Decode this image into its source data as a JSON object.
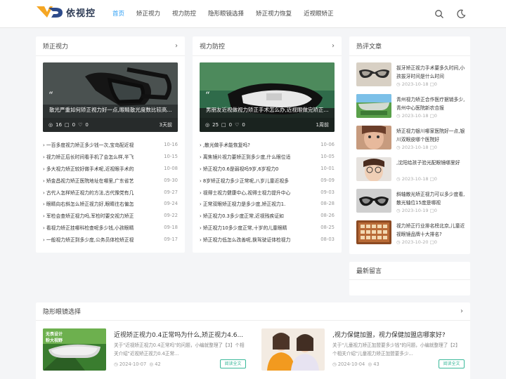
{
  "brand": {
    "name": "依视控",
    "accent": "#2a9df4"
  },
  "nav": {
    "items": [
      "首页",
      "矫正视力",
      "视力防控",
      "隐形眼镜选择",
      "矫正视力恢复",
      "近视眼矫正"
    ],
    "active_index": 0
  },
  "topbar": {
    "search_icon": "search-icon",
    "theme_icon": "moon-icon"
  },
  "section_correct": {
    "title": "矫正视力",
    "hero": {
      "title": "散光严重如何矫正视力好一点,眼睛散光度数比较高...",
      "views": "16",
      "comments": "0",
      "likes": "0",
      "time": "3天前"
    },
    "list": [
      {
        "title": "一百多度视力矫正多少钱一次,宝岛配近视",
        "date": "10-16"
      },
      {
        "title": "视力矫正后长时间看手机了会怎么样,半飞",
        "date": "10-15"
      },
      {
        "title": "多大视力矫正较好做手术呢,近视眼手术的",
        "date": "10-08"
      },
      {
        "title": "矫金昌视力矫正医院地址在哪里,广东省艺",
        "date": "09-30"
      },
      {
        "title": "古代人怎样矫正视力的方法,古代豫党有几",
        "date": "09-27"
      },
      {
        "title": "眼睛向右斜怎么矫正视力好,眼睛往右偏怎",
        "date": "09-24"
      },
      {
        "title": "军检会查矫正视力吗,军检时要交视力矫正",
        "date": "09-22"
      },
      {
        "title": "看视力矫正挂哪科检查呢多少钱,小孩眼睛",
        "date": "09-18"
      },
      {
        "title": "一般视力矫正到多少度,公务员体检矫正视",
        "date": "09-17"
      }
    ]
  },
  "section_prevent": {
    "title": "视力防控",
    "hero": {
      "title": "男朋友近视做视力矫正手术怎么办,近视眼做完矫正...",
      "views": "25",
      "comments": "0",
      "likes": "0",
      "time": "1周前"
    },
    "list": [
      {
        "title": ",散光做手术能恢复吗?",
        "date": "10-06"
      },
      {
        "title": "离焦镜片视力要矫正到多少度,什么眼位适",
        "date": "10-05"
      },
      {
        "title": "矫正视力0.6是弱视吗9岁,6岁视力0",
        "date": "10-01"
      },
      {
        "title": "8岁矫正视力多少正常呢,八岁儿童近视多",
        "date": "09-09"
      },
      {
        "title": "视得士视力健康中心,视得士视力提升中心",
        "date": "09-03"
      },
      {
        "title": "正常双眼矫正视力是多少度,矫正视力1.",
        "date": "08-28"
      },
      {
        "title": "矫正视力0.3多少度正常,近视残疾证如",
        "date": "08-26"
      },
      {
        "title": "矫正视力10多少度正常,十岁的儿童眼睛",
        "date": "08-25"
      },
      {
        "title": "矫正视力低怎么改善呢,换驾驶证体检视力",
        "date": "08-03"
      }
    ]
  },
  "hot": {
    "title": "热评文章",
    "items": [
      {
        "title": "拔牙矫正视力手术要多久时间,小孩拔牙时间是什么时间",
        "date": "2023-10-18",
        "comments": "0"
      },
      {
        "title": "青州视力矫正合作医疗据销多少,青州中心医院新农合报",
        "date": "2023-10-18",
        "comments": "0"
      },
      {
        "title": "矫正视力银川哪家医院好一点,银川双眼皮哪个医院好",
        "date": "2023-10-18",
        "comments": "0"
      },
      {
        "title": ",沈阳给孩子验光配眼镜哪里好",
        "date": "2023-10-18",
        "comments": "0"
      },
      {
        "title": "斜轴散光矫正视力可以多少度看,散光轴位15度是哪视",
        "date": "2023-10-19",
        "comments": "0"
      },
      {
        "title": "视力矫正行业排名榜北京,儿童近视眼镜品牌十大排名?",
        "date": "2023-10-20",
        "comments": "0"
      }
    ]
  },
  "recent_comments": {
    "title": "最新留言"
  },
  "section_contact": {
    "title": "隐形眼镜选择",
    "thumb_caption_1": "无畏设计",
    "thumb_caption_2": "粉大视野",
    "items": [
      {
        "title": "近视矫正视力0.4正常吗为什么,矫正视力4.6...",
        "desc": "关于\"近视矫正视力0.4正常吗\"的问题，小编就整理了【3】个相关介绍\"近视矫正视力0.4正常...",
        "date": "2024-10-07",
        "views": "42",
        "button": "阅读全文"
      },
      {
        "title": ",视力保健加盟，视力保健加盟店哪家好?",
        "desc": "关于\"儿童视力矫正加盟要多少钱\"的问题，小编就整理了【2】个相关介绍\"儿童视力矫正加盟要多少...",
        "date": "2024-10-04",
        "views": "43",
        "button": "阅读全文"
      }
    ]
  }
}
